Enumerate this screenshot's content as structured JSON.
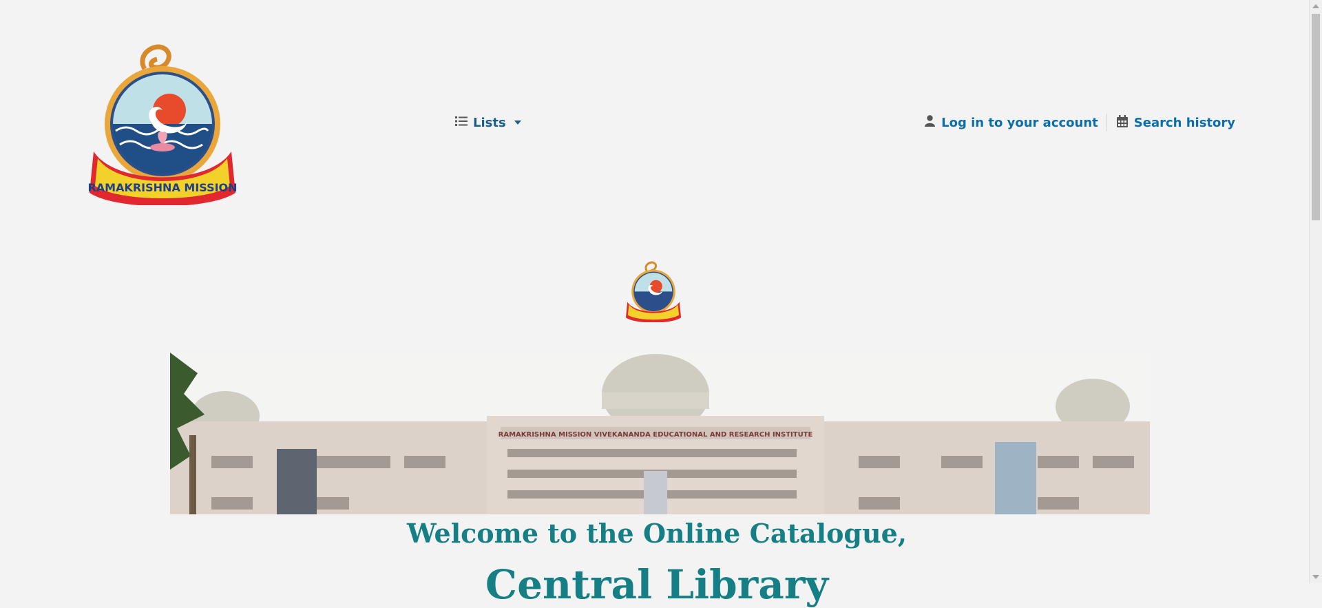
{
  "header": {
    "logo_alt": "Ramakrishna Mission",
    "logo_text": "RAMAKRISHNA MISSION",
    "nav": {
      "lists_label": "Lists",
      "lists_icon": "list-icon"
    },
    "account": {
      "login_label": "Log in to your account",
      "login_icon": "user-icon"
    },
    "history": {
      "search_history_label": "Search history",
      "search_history_icon": "calendar-icon"
    }
  },
  "banner": {
    "building_sign": "RAMAKRISHNA MISSION VIVEKANANDA EDUCATIONAL AND RESEARCH INSTITUTE"
  },
  "main": {
    "welcome_line1": "Welcome to the Online Catalogue,",
    "welcome_line2": "Central Library"
  },
  "colors": {
    "background": "#f3f3f3",
    "link": "#0b6ea9",
    "heading": "#157f85"
  }
}
